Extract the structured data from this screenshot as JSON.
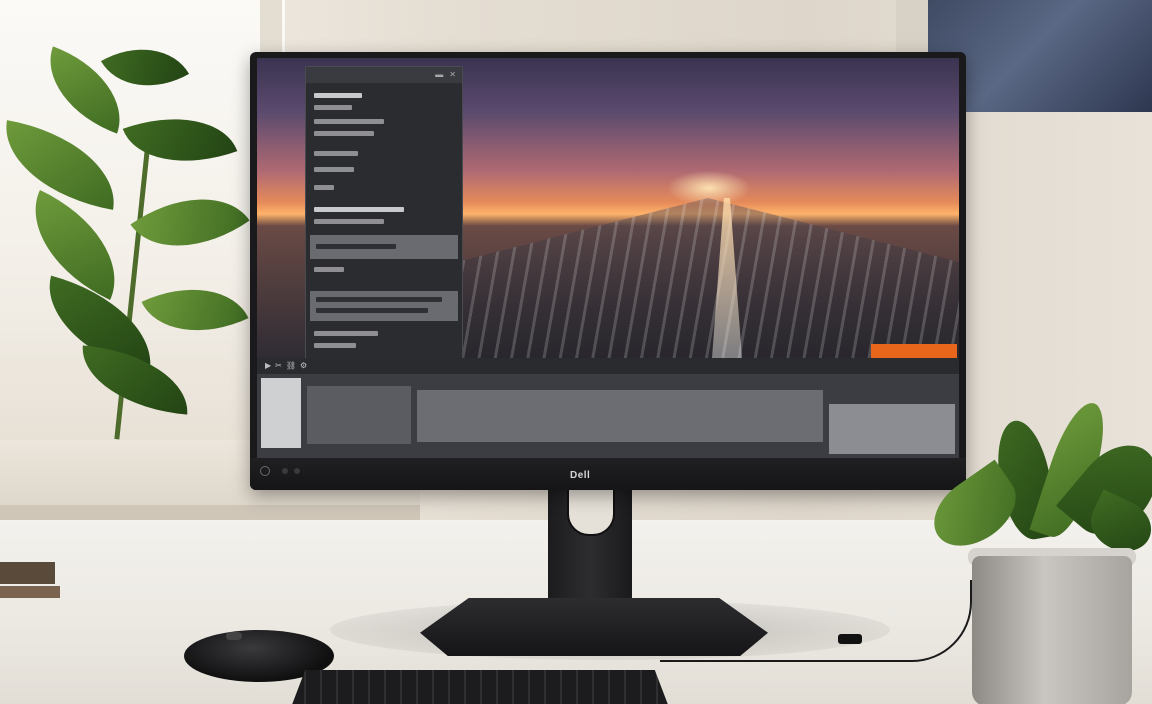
{
  "monitor": {
    "brand": "Dell",
    "screen": {
      "wallpaper": "sunset-highway-motion-blur",
      "accent_orange": "#e8651c"
    }
  },
  "colors": {
    "bezel": "#1a1a1c",
    "desk": "#f3f1ed",
    "wall": "#e9e3da",
    "plant": "#4f7d2c"
  },
  "icons": {
    "panel": [
      "minimize-icon",
      "close-icon"
    ],
    "timeline": [
      "play-icon",
      "cut-icon",
      "link-icon",
      "settings-icon"
    ]
  }
}
